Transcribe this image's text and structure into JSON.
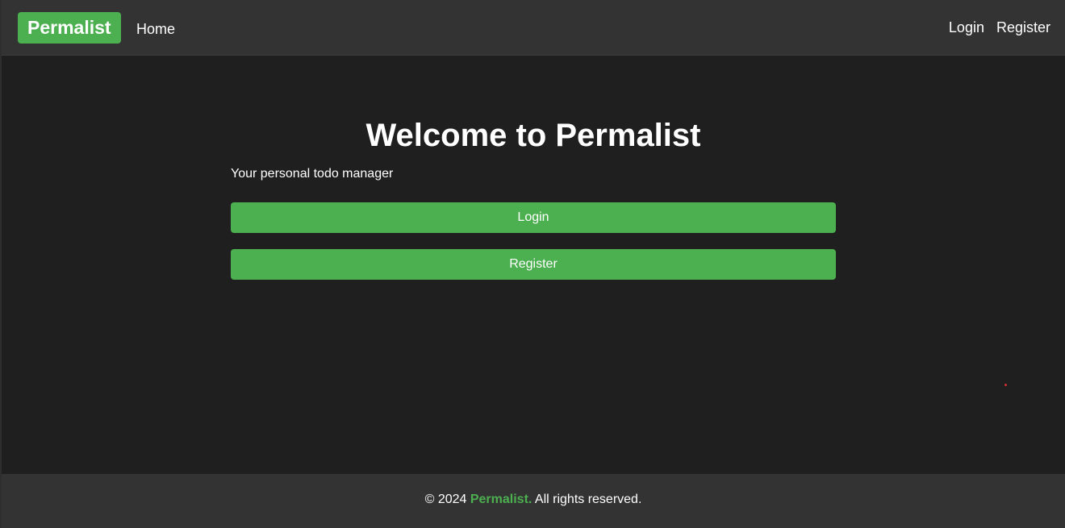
{
  "navbar": {
    "brand": "Permalist",
    "home": "Home",
    "login": "Login",
    "register": "Register"
  },
  "main": {
    "title": "Welcome to Permalist",
    "subtitle": "Your personal todo manager",
    "login_button": "Login",
    "register_button": "Register"
  },
  "footer": {
    "copyright": "© 2024",
    "brand": "Permalist.",
    "rights": "All rights reserved."
  },
  "colors": {
    "accent": "#4caf50",
    "background": "#1f1f1f",
    "bars": "#333333"
  }
}
